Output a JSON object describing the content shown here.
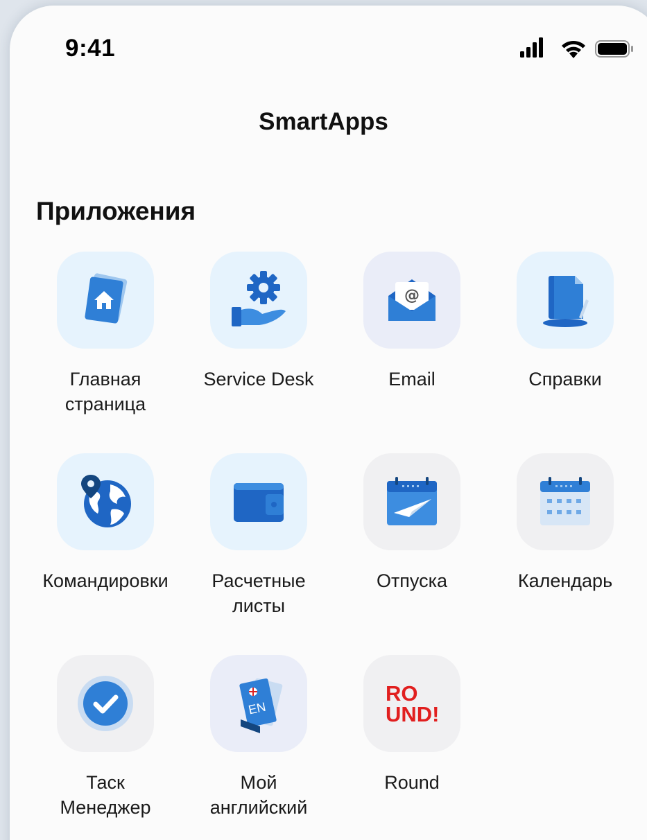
{
  "status_bar": {
    "time": "9:41",
    "icons": [
      "signal-icon",
      "wifi-icon",
      "battery-icon"
    ]
  },
  "header": {
    "title": "SmartApps"
  },
  "section": {
    "title": "Приложения"
  },
  "apps": [
    {
      "label": "Главная\nстраница",
      "icon": "home-document-icon"
    },
    {
      "label": "Service Desk",
      "icon": "gear-hand-icon"
    },
    {
      "label": "Email",
      "icon": "envelope-icon"
    },
    {
      "label": "Справки",
      "icon": "document-icon"
    },
    {
      "label": "Командировки",
      "icon": "globe-pin-icon"
    },
    {
      "label": "Расчетные\nлисты",
      "icon": "wallet-icon"
    },
    {
      "label": "Отпуска",
      "icon": "calendar-plane-icon"
    },
    {
      "label": "Календарь",
      "icon": "calendar-icon"
    },
    {
      "label": "Таск\nМенеджер",
      "icon": "checkmark-icon"
    },
    {
      "label": "Мой\nанглийский",
      "icon": "book-en-icon"
    },
    {
      "label": "Round",
      "icon": "round-logo"
    }
  ],
  "book_text": "EN",
  "round_logo_lines": [
    "RO",
    "UND!"
  ],
  "colors": {
    "accent_blue": "#2f7fd6",
    "icon_bg_blue": "#e6f3fd",
    "icon_bg_lavender": "#eaedf8",
    "icon_bg_gray": "#f0f0f2",
    "round_red": "#e11f1f"
  }
}
